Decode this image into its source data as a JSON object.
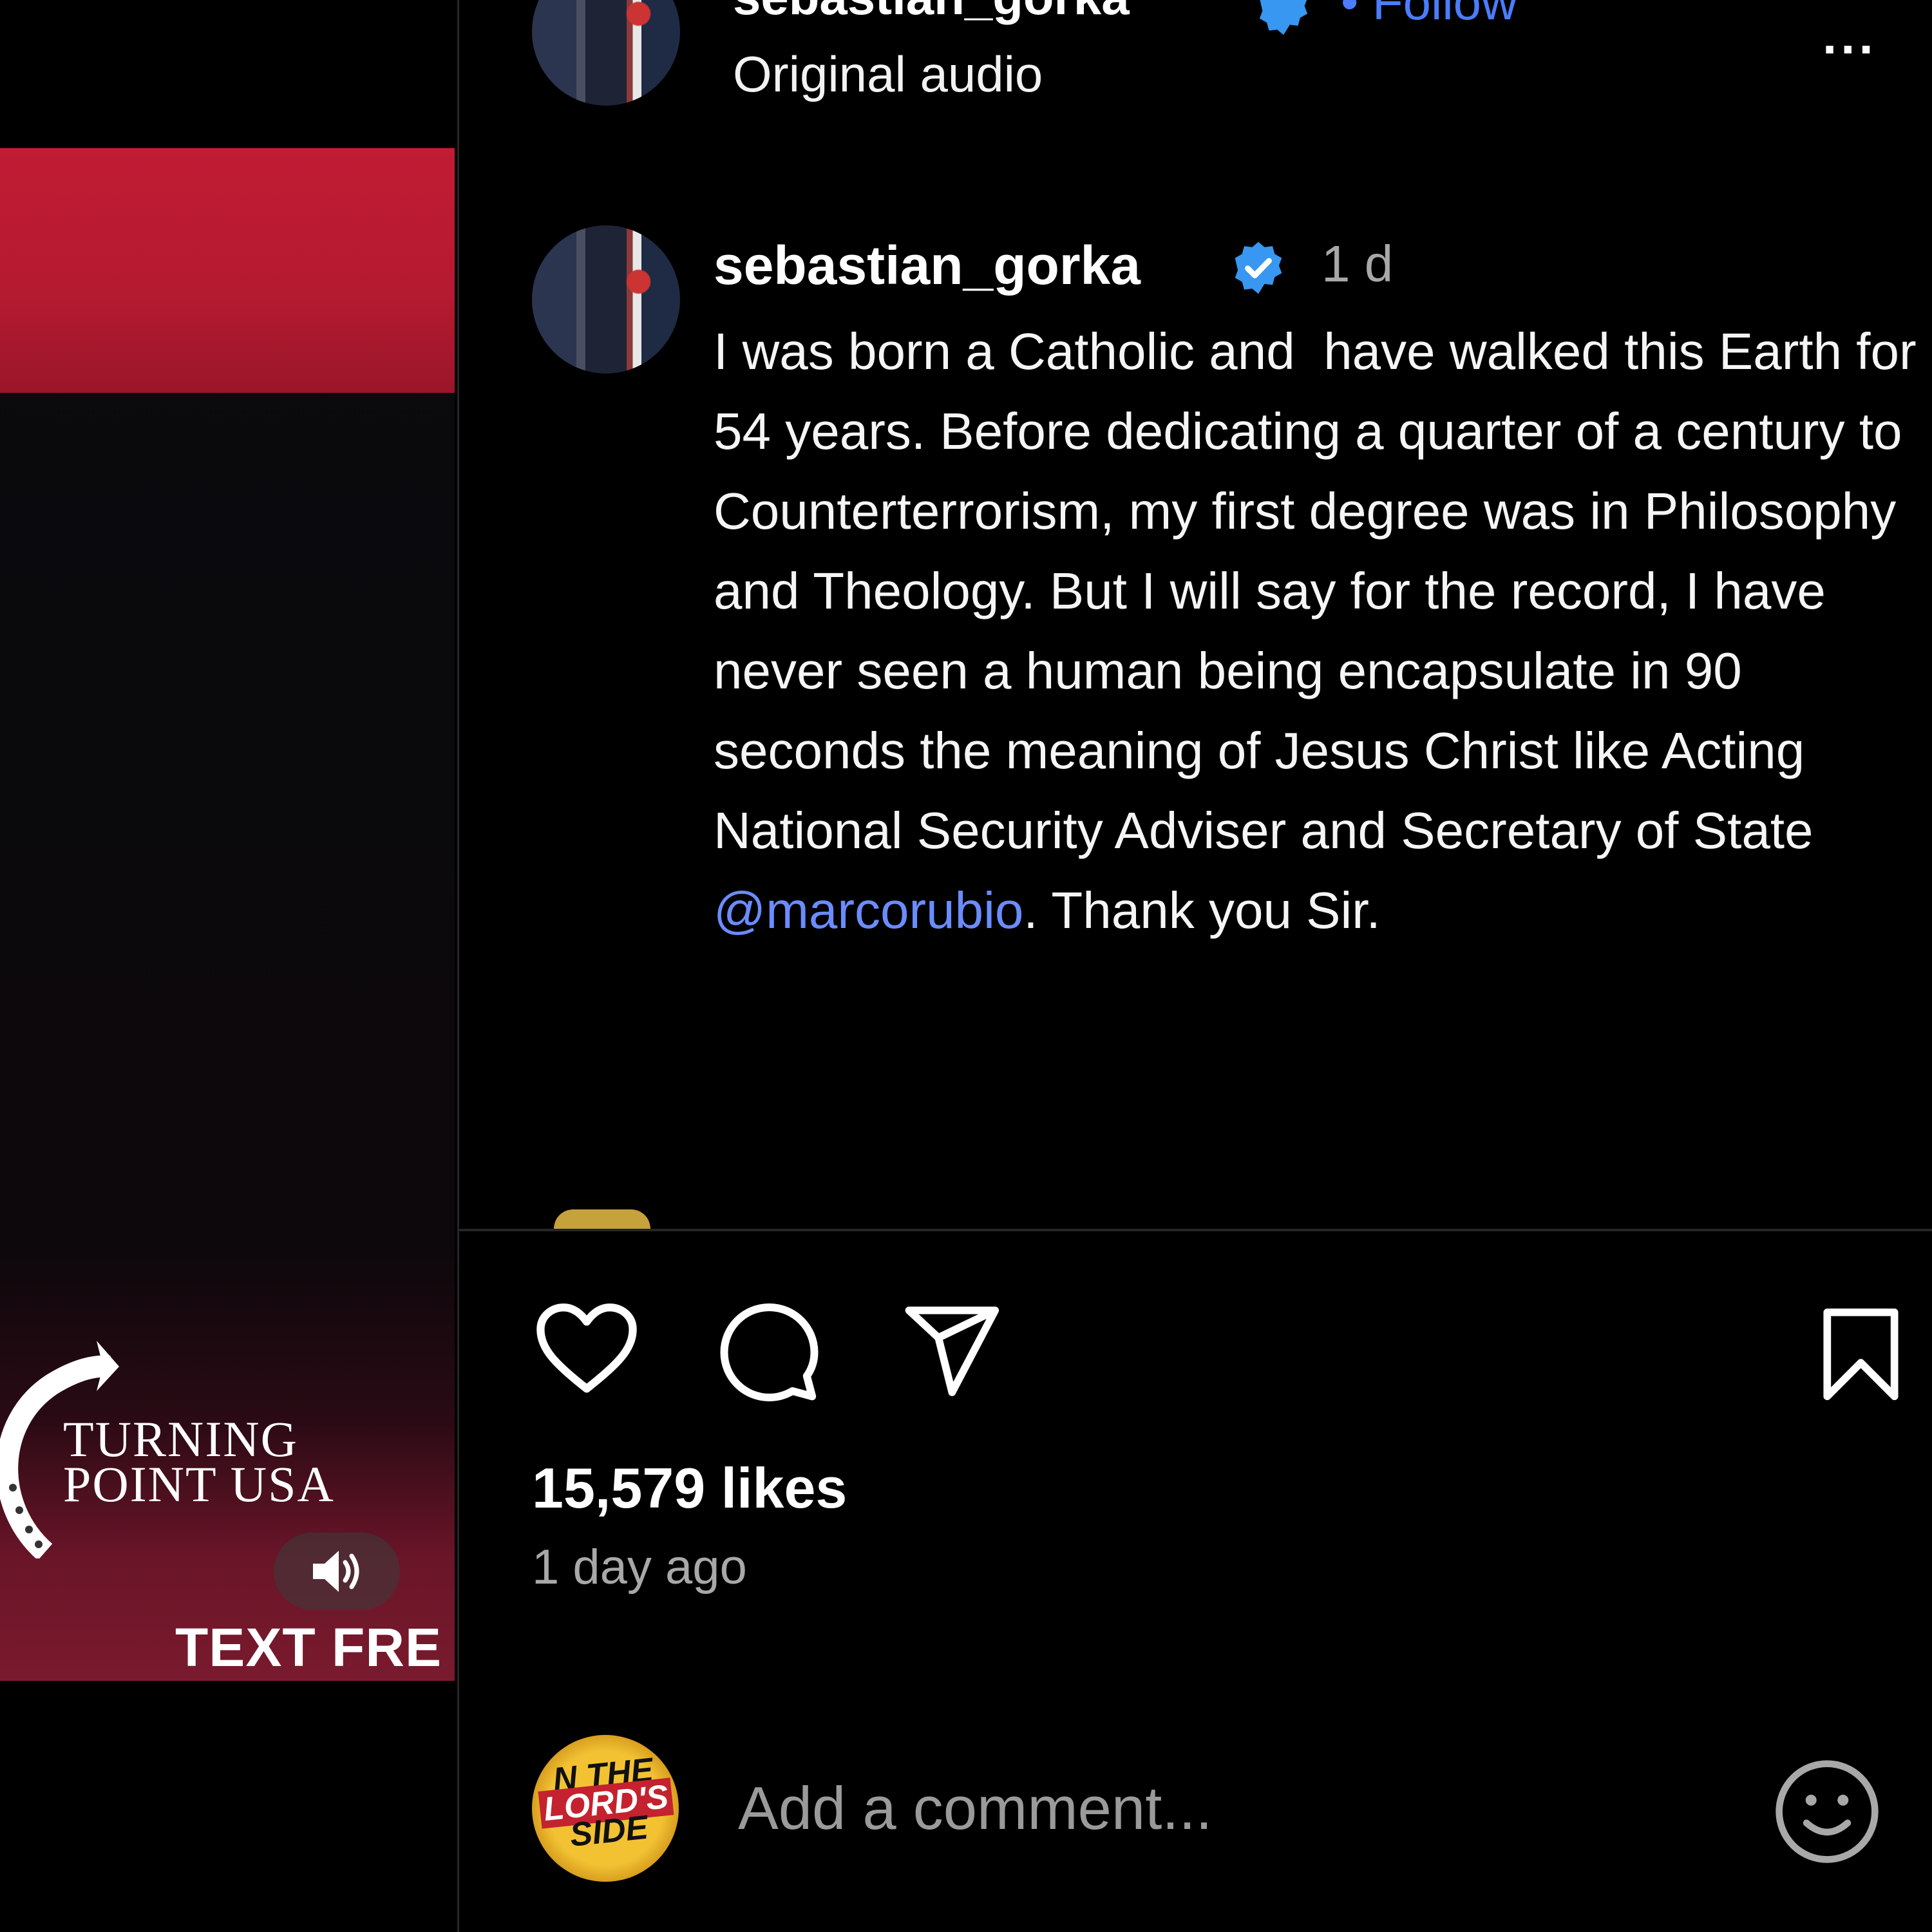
{
  "video": {
    "logo_text_line1": "TURNING",
    "logo_text_line2": "POINT USA",
    "overlay_text": "TEXT FRE",
    "mute_icon": "speaker-icon"
  },
  "post_header": {
    "username": "sebastian_gorka",
    "separator": "•",
    "follow_label": "Follow",
    "audio_label": "Original audio",
    "more_label": "..."
  },
  "caption": {
    "username": "sebastian_gorka",
    "time": "1 d",
    "text_before": "I was born a Catholic and  have walked this Earth for  54 years. Before dedicating a quarter of a century to Counterterrorism, my first degree was in Philosophy and Theology. But I will say for the record, I have never seen a human being encapsulate in 90 seconds the meaning of Jesus Christ like Acting National Security Adviser and Secretary of State ",
    "mention": "@marcorubio",
    "text_after": ". Thank you Sir."
  },
  "actions": {
    "like_icon": "heart-icon",
    "comment_icon": "comment-icon",
    "share_icon": "send-icon",
    "save_icon": "bookmark-icon"
  },
  "stats": {
    "likes": "15,579 likes",
    "posted": "1 day ago"
  },
  "comment_box": {
    "avatar_text_1": "N THE",
    "avatar_text_2": "LORD'S",
    "avatar_text_3": "SIDE",
    "placeholder": "Add a comment...",
    "emoji_icon": "smiley-icon"
  },
  "colors": {
    "background": "#000000",
    "link": "#6b8cff",
    "follow": "#4a7dff",
    "verified": "#3897f0",
    "muted_text": "#a8a8a8",
    "banner_red": "#c01c34"
  }
}
